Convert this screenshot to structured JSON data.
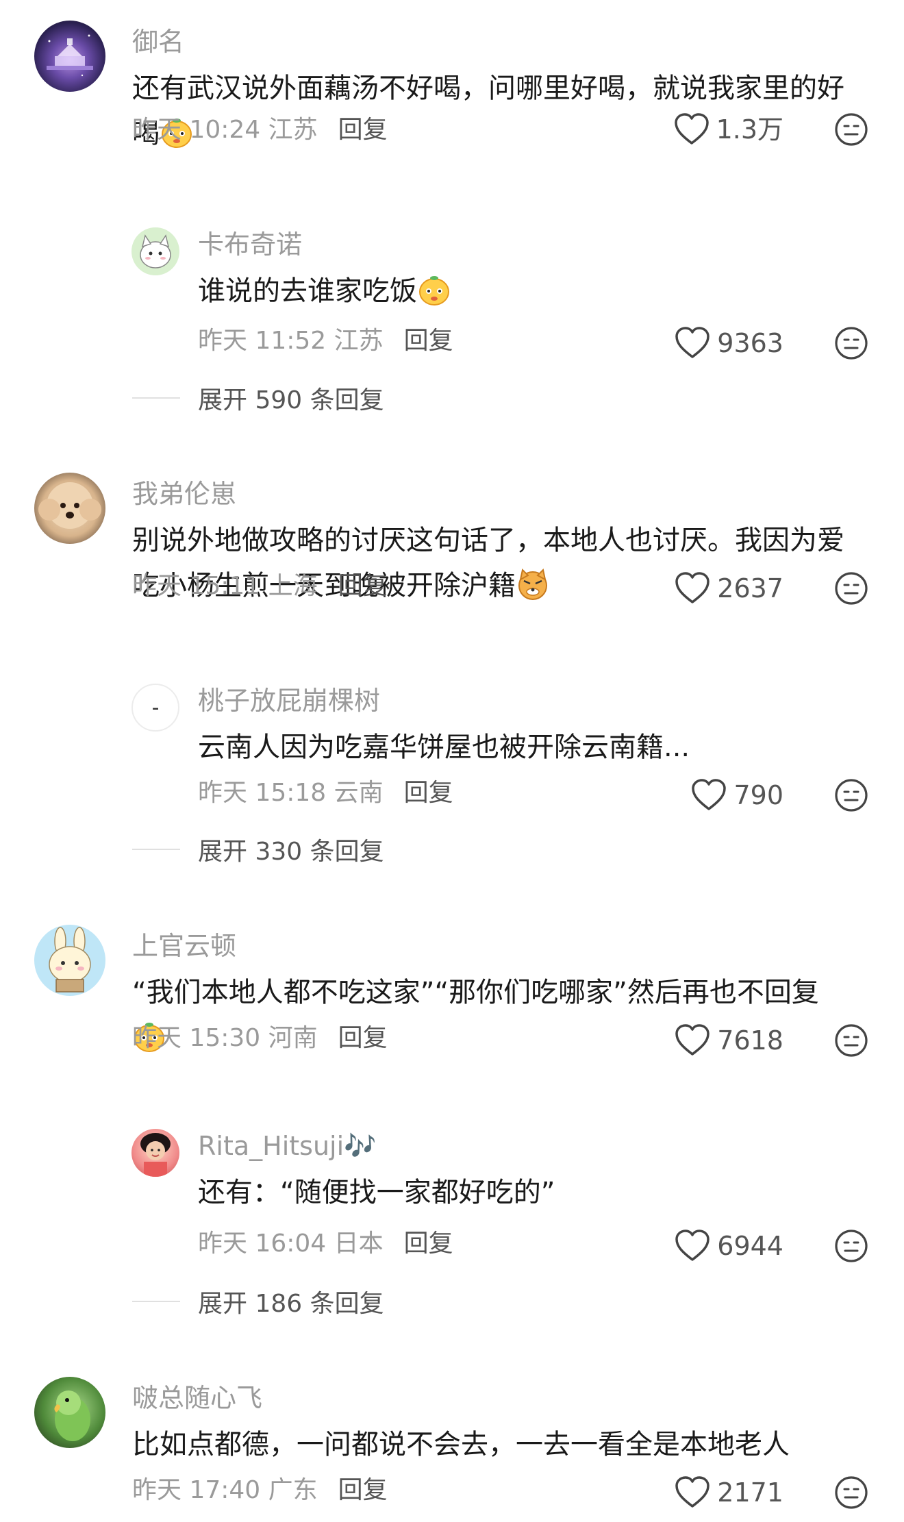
{
  "comments": [
    {
      "name": "御名",
      "text": "还有武汉说外面藕汤不好喝，问哪里好喝，就说我家里的好喝",
      "time": "昨天 10:24 江苏",
      "reply_label": "回复",
      "likes": "1.3万",
      "avatar": "castle-night-avatar",
      "replies": [
        {
          "name": "卡布奇诺",
          "text": "谁说的去谁家吃饭",
          "time": "昨天 11:52 江苏",
          "reply_label": "回复",
          "likes": "9363",
          "avatar": "white-cat-cartoon-avatar"
        }
      ],
      "expand_label": "展开 590 条回复"
    },
    {
      "name": "我弟伦崽",
      "text": "别说外地做攻略的讨厌这句话了，本地人也讨厌。我因为爱吃小杨生煎一天到晚被开除沪籍",
      "time": "昨天 15:11 上海",
      "reply_label": "回复",
      "likes": "2637",
      "avatar": "poodle-dog-avatar",
      "replies": [
        {
          "name": "桃子放屁崩棵树",
          "text": "云南人因为吃嘉华饼屋也被开除云南籍...",
          "time": "昨天 15:18 云南",
          "reply_label": "回复",
          "likes": "790",
          "avatar_glyph": "-"
        }
      ],
      "expand_label": "展开 330 条回复"
    },
    {
      "name": "上官云顿",
      "text": "“我们本地人都不吃这家”“那你们吃哪家”然后再也不回复",
      "time": "昨天 15:30 河南",
      "reply_label": "回复",
      "likes": "7618",
      "avatar": "bunny-cartoon-avatar",
      "replies": [
        {
          "name": "Rita_Hitsuji🎶",
          "text": "还有：“随便找一家都好吃的”",
          "time": "昨天 16:04 日本",
          "reply_label": "回复",
          "likes": "6944",
          "avatar": "girl-photo-avatar"
        }
      ],
      "expand_label": "展开 186 条回复"
    },
    {
      "name": "啵总随心飞",
      "text": "比如点都德，一问都说不会去，一去一看全是本地老人",
      "time": "昨天 17:40 广东",
      "reply_label": "回复",
      "likes": "2171",
      "avatar": "green-parrot-avatar"
    }
  ]
}
